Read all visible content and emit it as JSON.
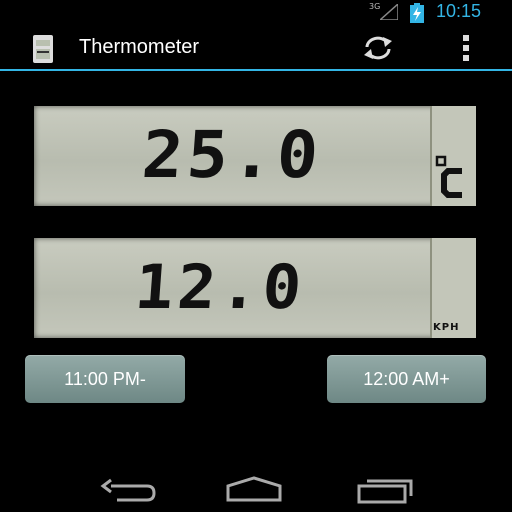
{
  "status_bar": {
    "network": "3G",
    "time": "10:15"
  },
  "app": {
    "title": "Thermometer"
  },
  "lcd_temperature": {
    "value": "25.0",
    "unit": "°C"
  },
  "lcd_speed": {
    "value": "12.0",
    "unit": "KPH"
  },
  "buttons": {
    "left_label": "11:00 PM-",
    "right_label": "12:00 AM+"
  },
  "icons": {
    "app": "thermometer-app-icon",
    "refresh": "refresh-icon",
    "overflow": "overflow-menu-icon",
    "signal": "signal-icon",
    "battery": "battery-charging-icon",
    "back": "back-icon",
    "home": "home-icon",
    "recent": "recent-apps-icon"
  },
  "colors": {
    "accent": "#33b5e5",
    "lcd": "#c2c5b8",
    "button": "#7f9996"
  }
}
